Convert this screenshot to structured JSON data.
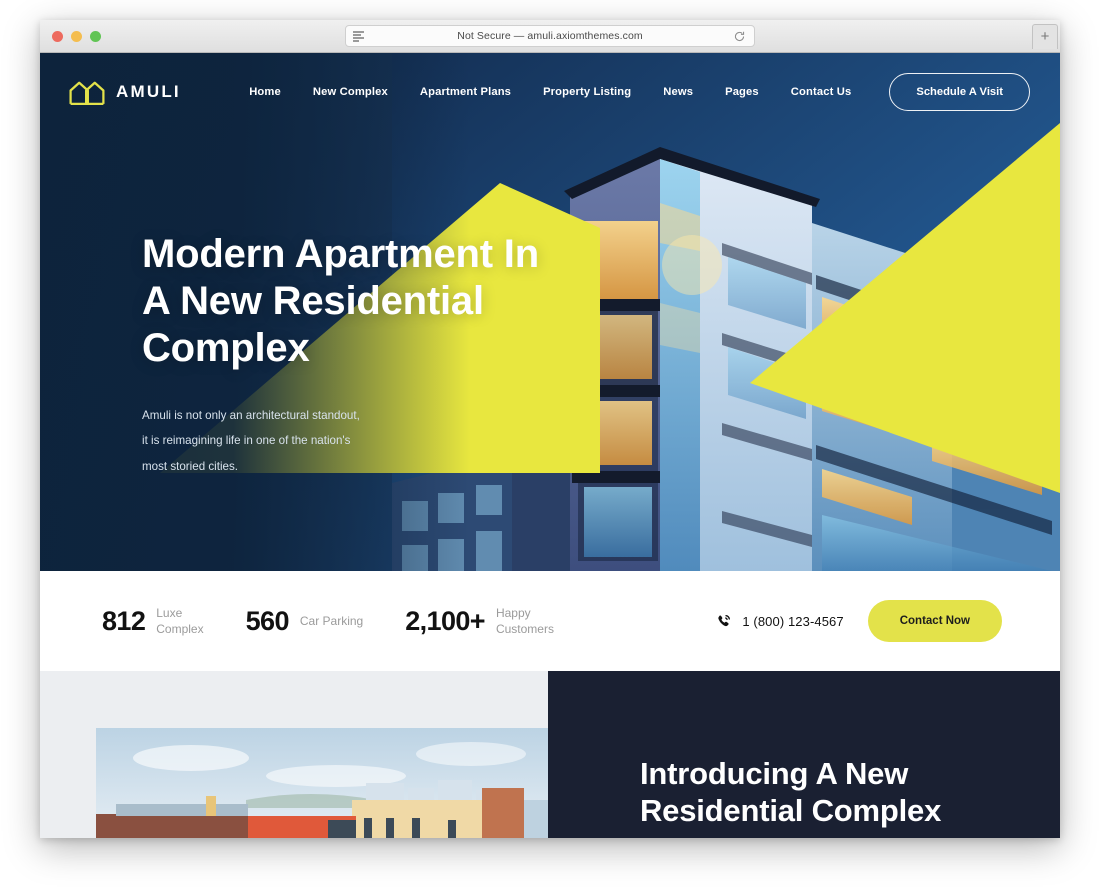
{
  "browser": {
    "url_text": "Not Secure — amuli.axiomthemes.com",
    "reader_icon": "reader-view-icon",
    "reload_icon": "reload-icon",
    "new_tab_label": "+",
    "traffic_lights": [
      "close-button",
      "minimize-button",
      "maximize-button"
    ]
  },
  "site": {
    "brand": {
      "name": "AMULI",
      "logo_icon": "house-arch-logo-icon",
      "logo_color": "#e3e24a"
    },
    "nav": {
      "items": [
        {
          "label": "Home"
        },
        {
          "label": "New Complex"
        },
        {
          "label": "Apartment Plans"
        },
        {
          "label": "Property Listing"
        },
        {
          "label": "News"
        },
        {
          "label": "Pages"
        },
        {
          "label": "Contact Us"
        }
      ],
      "cta_label": "Schedule A Visit"
    },
    "hero": {
      "title_line1": "Modern Apartment In",
      "title_line2": "A New Residential",
      "title_line3": "Complex",
      "sub_line1": "Amuli is not only an architectural standout,",
      "sub_line2": "it is reimagining life in one of the nation's",
      "sub_line3": "most storied cities.",
      "accent_color": "#e8e73f",
      "background_color": "#153257"
    },
    "stats": {
      "items": [
        {
          "number": "812",
          "label_line1": "Luxe",
          "label_line2": "Complex"
        },
        {
          "number": "560",
          "label_line1": "Car Parking",
          "label_line2": ""
        },
        {
          "number": "2,100+",
          "label_line1": "Happy",
          "label_line2": "Customers"
        }
      ],
      "phone_icon": "phone-icon",
      "phone_number": "1 (800) 123-4567",
      "contact_button_label": "Contact Now",
      "contact_button_color": "#e3e24a"
    },
    "intro": {
      "title_line1": "Introducing A New",
      "title_line2": "Residential Complex",
      "panel_color": "#1a2032",
      "image_alt": "city-skyline-rooftop-photo"
    }
  }
}
